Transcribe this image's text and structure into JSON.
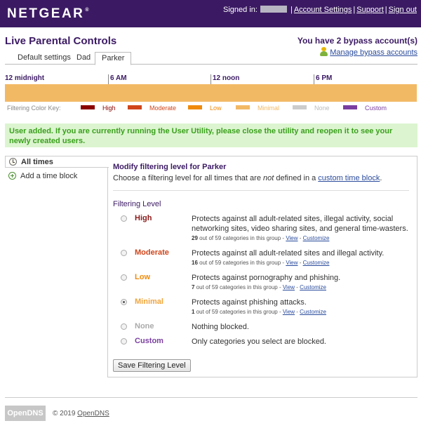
{
  "header": {
    "brand": "NETGEAR",
    "signed_in_label": "Signed in:",
    "links": {
      "account_settings": "Account Settings",
      "support": "Support",
      "sign_out": "Sign out"
    },
    "separator": "|"
  },
  "page": {
    "title": "Live Parental Controls",
    "bypass_text": "You have 2 bypass account(s)",
    "manage_bypass_link": "Manage bypass accounts"
  },
  "tabs": [
    {
      "label": "Default settings",
      "active": false
    },
    {
      "label": "Dad",
      "active": false
    },
    {
      "label": "Parker",
      "active": true
    }
  ],
  "timeline": {
    "hours": [
      "12 midnight",
      "6 AM",
      "12 noon",
      "6 PM"
    ],
    "bar_color": "#f2b965"
  },
  "color_key": {
    "label": "Filtering Color Key:",
    "items": [
      {
        "name": "High",
        "color": "#8b0000"
      },
      {
        "name": "Moderate",
        "color": "#d0451b"
      },
      {
        "name": "Low",
        "color": "#f08a0c"
      },
      {
        "name": "Minimal",
        "color": "#f2b965"
      },
      {
        "name": "None",
        "color": "#cccccc"
      },
      {
        "name": "Custom",
        "color": "#7a3ea0"
      }
    ]
  },
  "notice": "User added. If you are currently running the User Utility, please close the utility and reopen it to see your newly created users.",
  "sidebar": {
    "items": [
      {
        "label": "All times",
        "icon": "clock-icon",
        "active": true
      },
      {
        "label": "Add a time block",
        "icon": "add-icon",
        "active": false
      }
    ]
  },
  "panel": {
    "title": "Modify filtering level for Parker",
    "subtitle_pre": "Choose a filtering level for all times that are ",
    "subtitle_em": "not",
    "subtitle_mid": " defined in a ",
    "subtitle_link": "custom time block",
    "subtitle_post": ".",
    "filtering_level_label": "Filtering Level",
    "levels": [
      {
        "name": "High",
        "color": "#8b1a1a",
        "checked": false,
        "description": "Protects against all adult-related sites, illegal activity, social networking sites, video sharing sites, and general time-wasters.",
        "count": "29",
        "count_text": " out of 59 categories in this group - ",
        "view": "View",
        "customize": "Customize"
      },
      {
        "name": "Moderate",
        "color": "#d0451b",
        "checked": false,
        "description": "Protects against all adult-related sites and illegal activity.",
        "count": "16",
        "count_text": " out of 59 categories in this group - ",
        "view": "View",
        "customize": "Customize"
      },
      {
        "name": "Low",
        "color": "#f08a0c",
        "checked": false,
        "description": "Protects against pornography and phishing.",
        "count": "7",
        "count_text": " out of 59 categories in this group - ",
        "view": "View",
        "customize": "Customize"
      },
      {
        "name": "Minimal",
        "color": "#f2a53c",
        "checked": true,
        "description": "Protects against phishing attacks.",
        "count": "1",
        "count_text": " out of 59 categories in this group - ",
        "view": "View",
        "customize": "Customize"
      },
      {
        "name": "None",
        "color": "#aaaaaa",
        "checked": false,
        "description": "Nothing blocked."
      },
      {
        "name": "Custom",
        "color": "#7a3ea0",
        "checked": false,
        "description": "Only categories you select are blocked."
      }
    ],
    "save_button": "Save Filtering Level"
  },
  "footer": {
    "logo": "OpenDNS",
    "copyright_pre": "© 2019 ",
    "copyright_link": "OpenDNS"
  }
}
